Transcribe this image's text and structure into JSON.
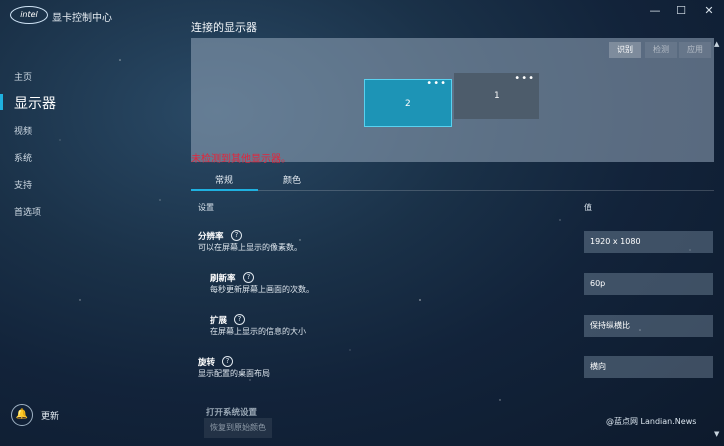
{
  "app": {
    "logo_text": "intel",
    "title": "显卡控制中心"
  },
  "window": {
    "minimize": "—",
    "maximize": "☐",
    "close": "✕"
  },
  "sidebar": {
    "items": [
      {
        "label": "主页"
      },
      {
        "label": "显示器",
        "active": true
      },
      {
        "label": "视频"
      },
      {
        "label": "系统"
      },
      {
        "label": "支持"
      },
      {
        "label": "首选项"
      }
    ],
    "update_label": "更新"
  },
  "main": {
    "heading": "连接的显示器",
    "panel_buttons": {
      "identify": "识别",
      "detect": "检测",
      "apply": "应用"
    },
    "monitors": [
      {
        "label": "2",
        "selected": true
      },
      {
        "label": "1",
        "selected": false
      }
    ],
    "warning": "未检测到其他显示器。",
    "tabs": [
      {
        "label": "常规",
        "selected": true
      },
      {
        "label": "颜色",
        "selected": false
      }
    ],
    "columns": {
      "settings": "设置",
      "value": "值"
    },
    "rows": [
      {
        "title": "分辨率",
        "desc": "可以在屏幕上显示的像素数。",
        "value": "1920 x 1080"
      },
      {
        "title": "刷新率",
        "desc": "每秒更新屏幕上画面的次数。",
        "value": "60p"
      },
      {
        "title": "扩展",
        "desc": "在屏幕上显示的信息的大小",
        "value": "保持纵横比"
      },
      {
        "title": "旋转",
        "desc": "显示配置的桌面布局",
        "value": "横向"
      }
    ],
    "partial_heading": "打开系统设置",
    "reset_button": "恢复到原始颜色"
  },
  "watermark": "@蓝点网 Landian.News",
  "colors": {
    "accent": "#1fb1e0",
    "warning": "#e4243a",
    "selected_monitor": "#1d94b6"
  }
}
